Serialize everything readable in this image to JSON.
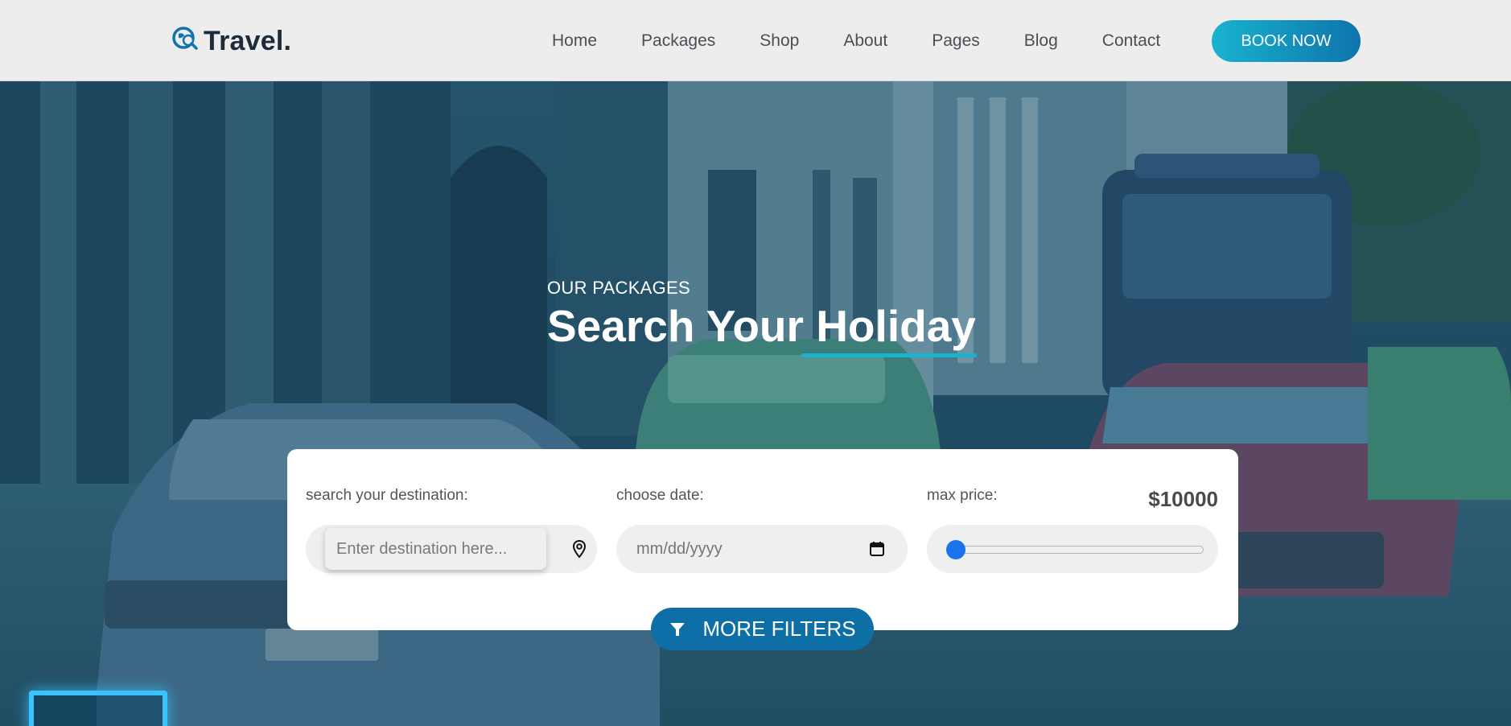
{
  "logo": {
    "text": "Travel",
    "dot": ".",
    "icon": "globe-search-icon"
  },
  "nav": {
    "items": [
      "Home",
      "Packages",
      "Shop",
      "About",
      "Pages",
      "Blog",
      "Contact"
    ],
    "cta": "BOOK NOW"
  },
  "hero": {
    "kicker": "OUR PACKAGES",
    "title": "Search Your Holiday"
  },
  "search": {
    "destination": {
      "label": "search your destination:",
      "placeholder": "Enter destination here...",
      "icon": "location-pin-icon"
    },
    "date": {
      "label": "choose date:",
      "placeholder": "mm/dd/yyyy",
      "icon": "calendar-icon"
    },
    "price": {
      "label": "max price:",
      "value": "$10000",
      "slider_fraction": 0.0
    },
    "more_filters": {
      "label": "MORE FILTERS",
      "icon": "filter-icon"
    }
  },
  "colors": {
    "accent": "#19b3cf",
    "brand": "#0d6fa6",
    "slider": "#1a73e8"
  }
}
